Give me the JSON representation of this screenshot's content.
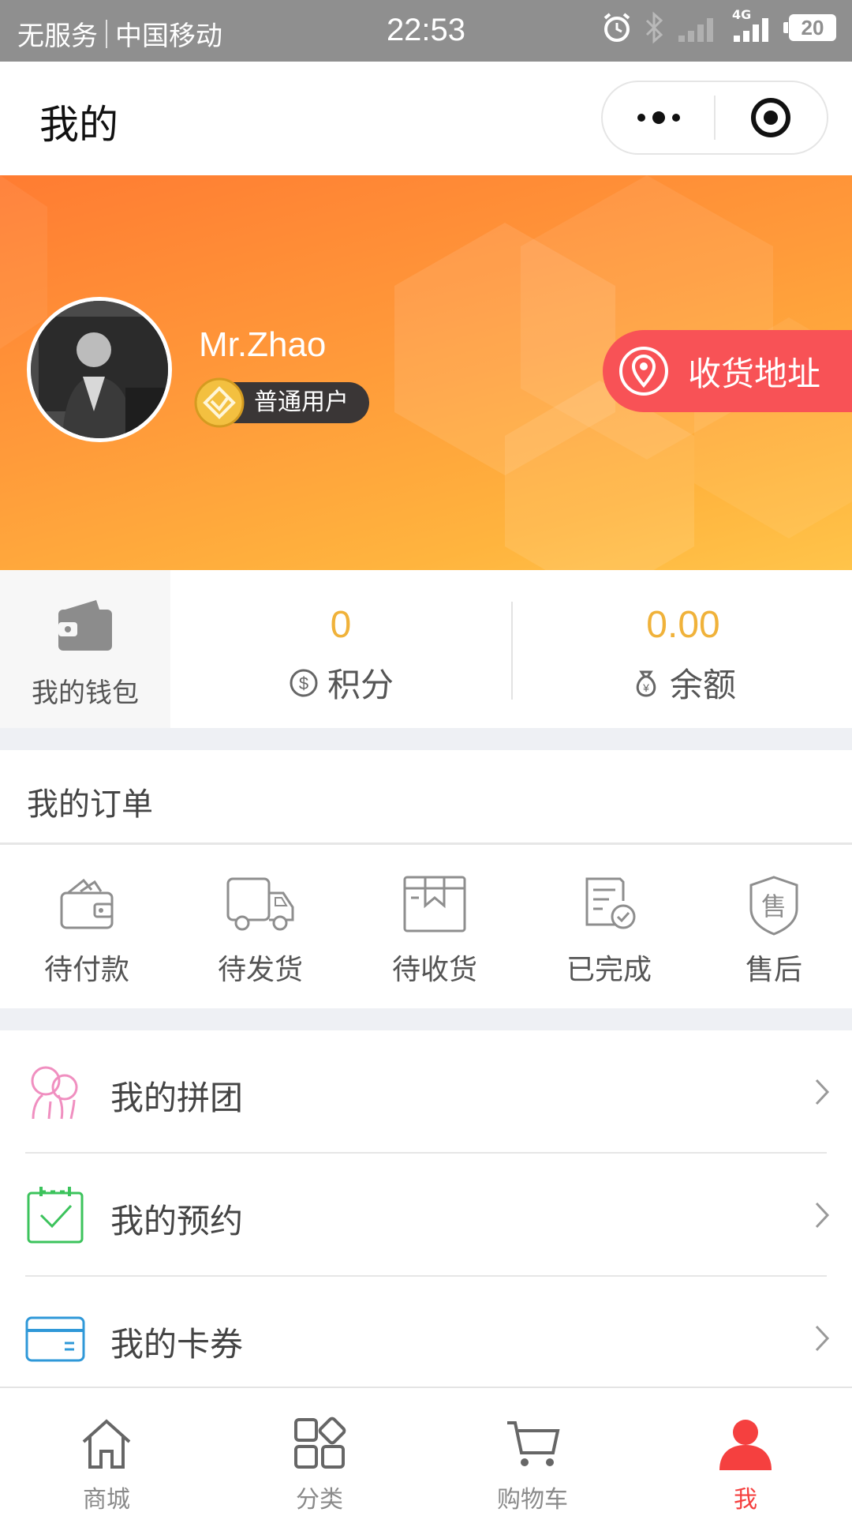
{
  "status_bar": {
    "carrier_1": "无服务",
    "carrier_2": "中国移动",
    "time": "22:53",
    "network": "4G",
    "battery": "20"
  },
  "nav": {
    "title": "我的",
    "more_icon": "more-dots-icon",
    "close_icon": "target-circle-icon"
  },
  "profile": {
    "name": "Mr.Zhao",
    "level": "普通用户",
    "address_label": "收货地址"
  },
  "wallet": {
    "label": "我的钱包",
    "points_value": "0",
    "points_label": "积分",
    "balance_value": "0.00",
    "balance_label": "余额"
  },
  "orders": {
    "title": "我的订单",
    "items": [
      {
        "label": "待付款",
        "icon": "wallet-icon"
      },
      {
        "label": "待发货",
        "icon": "truck-icon"
      },
      {
        "label": "待收货",
        "icon": "box-icon"
      },
      {
        "label": "已完成",
        "icon": "document-check-icon"
      },
      {
        "label": "售后",
        "icon": "after-sale-shield-icon"
      }
    ]
  },
  "menu": [
    {
      "label": "我的拼团",
      "icon": "group-buy-icon",
      "color": "#f08fc0"
    },
    {
      "label": "我的预约",
      "icon": "calendar-check-icon",
      "color": "#3cc35c"
    },
    {
      "label": "我的卡券",
      "icon": "card-icon",
      "color": "#2f98d8"
    }
  ],
  "tabs": [
    {
      "label": "商城",
      "icon": "home-icon"
    },
    {
      "label": "分类",
      "icon": "category-icon"
    },
    {
      "label": "购物车",
      "icon": "cart-icon"
    },
    {
      "label": "我",
      "icon": "user-icon",
      "active": true
    }
  ],
  "colors": {
    "accent": "#f5403f",
    "value_gold": "#f0b23a",
    "address_red": "#f85256"
  }
}
